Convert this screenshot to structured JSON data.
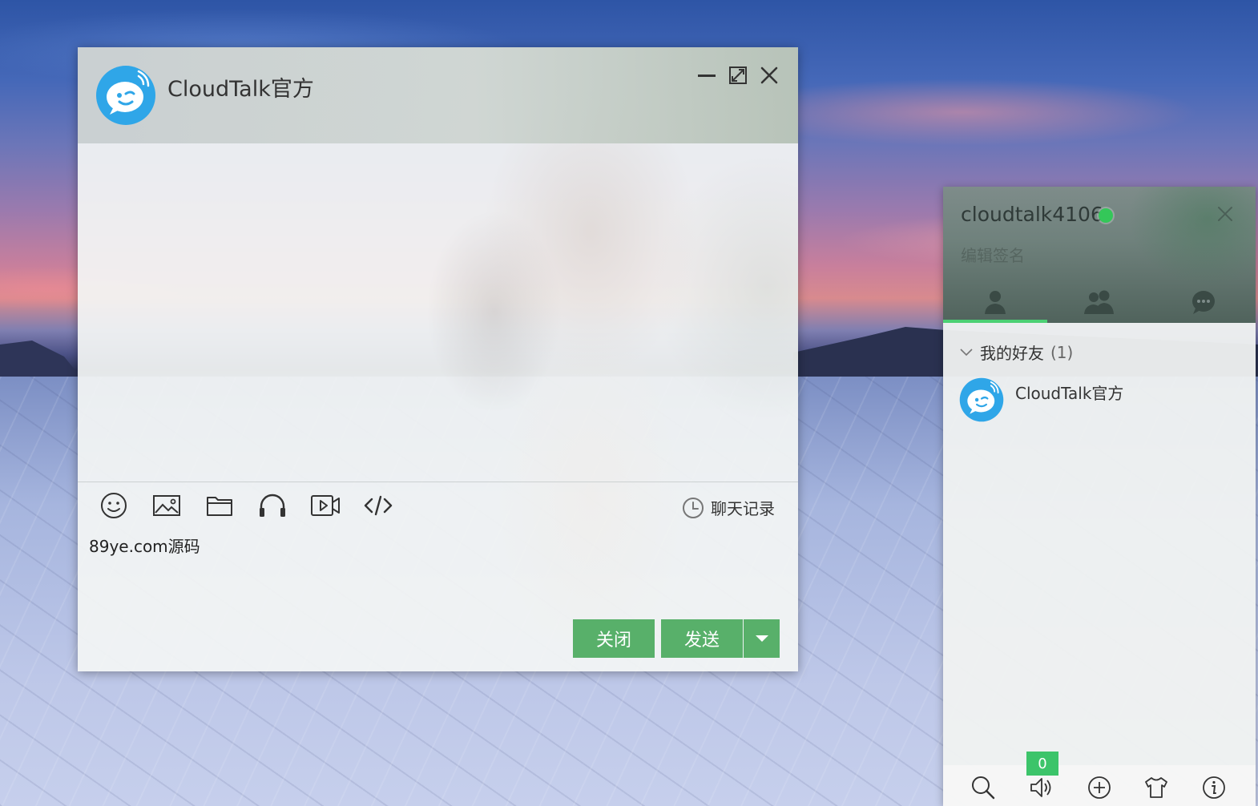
{
  "chat_window": {
    "title": "CloudTalk官方",
    "avatar_icon": "cloudtalk-logo-icon",
    "window_controls": {
      "minimize_icon": "minimize-icon",
      "maximize_icon": "maximize-icon",
      "close_icon": "close-icon"
    },
    "toolbar": {
      "tools": [
        {
          "name": "emoji",
          "icon": "emoji-icon"
        },
        {
          "name": "image",
          "icon": "image-icon"
        },
        {
          "name": "file",
          "icon": "folder-icon"
        },
        {
          "name": "audio",
          "icon": "headphones-icon"
        },
        {
          "name": "video",
          "icon": "video-icon"
        },
        {
          "name": "code",
          "icon": "code-icon"
        }
      ],
      "history_label": "聊天记录",
      "history_icon": "clock-icon"
    },
    "input": {
      "value": "89ye.com源码"
    },
    "buttons": {
      "close_label": "关闭",
      "send_label": "发送",
      "send_options_icon": "caret-down-icon"
    }
  },
  "contacts_panel": {
    "profile": {
      "username": "cloudtalk4106",
      "status": "online",
      "status_color": "#34c759",
      "signature_placeholder": "编辑签名"
    },
    "tabs": [
      {
        "name": "friends",
        "icon": "user-icon",
        "active": true
      },
      {
        "name": "groups",
        "icon": "users-icon",
        "active": false
      },
      {
        "name": "conversations",
        "icon": "chat-bubble-icon",
        "active": false
      }
    ],
    "group": {
      "name": "我的好友",
      "count": "(1)"
    },
    "contacts": [
      {
        "name": "CloudTalk官方",
        "avatar_icon": "cloudtalk-logo-icon"
      }
    ],
    "footer": {
      "icons": [
        "search-icon",
        "speaker-icon",
        "add-icon",
        "shirt-icon",
        "info-icon"
      ],
      "badge_count": "0"
    }
  },
  "colors": {
    "accent_green": "#58b06a",
    "indicator_green": "#4cd074",
    "badge_green": "#3cc46a",
    "avatar_blue": "#2fa6e8"
  }
}
